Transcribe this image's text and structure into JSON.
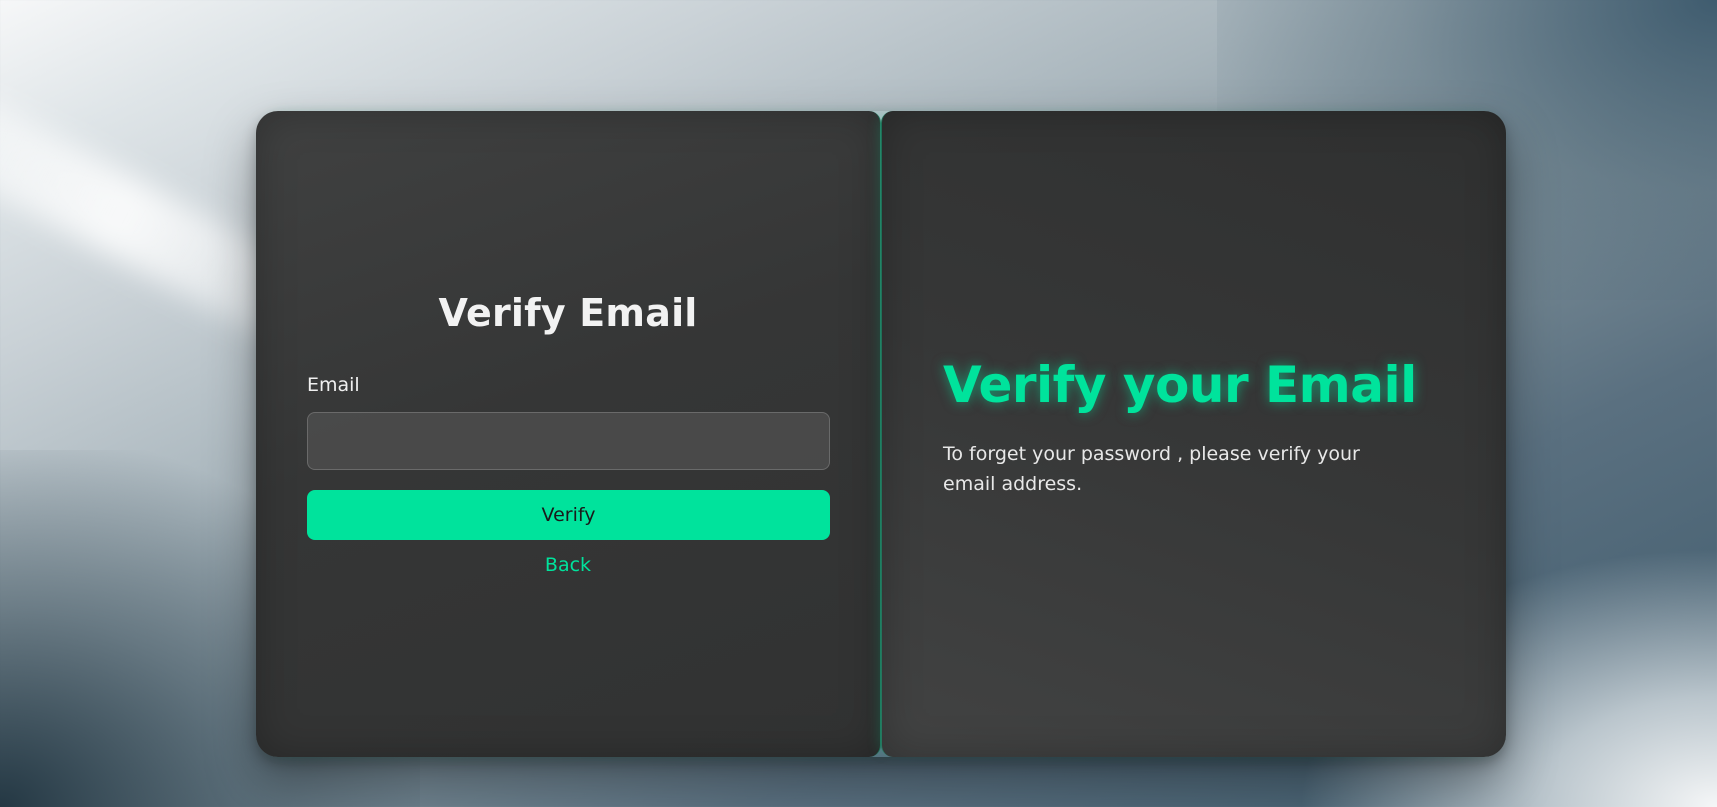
{
  "form": {
    "title": "Verify Email",
    "email_label": "Email",
    "email_value": "",
    "email_placeholder": "",
    "verify_label": "Verify",
    "back_label": "Back"
  },
  "info": {
    "title": "Verify your Email",
    "description": "To forget your password , please verify your email address."
  },
  "colors": {
    "accent": "#00e39c",
    "panel": "#3a3b3b"
  }
}
